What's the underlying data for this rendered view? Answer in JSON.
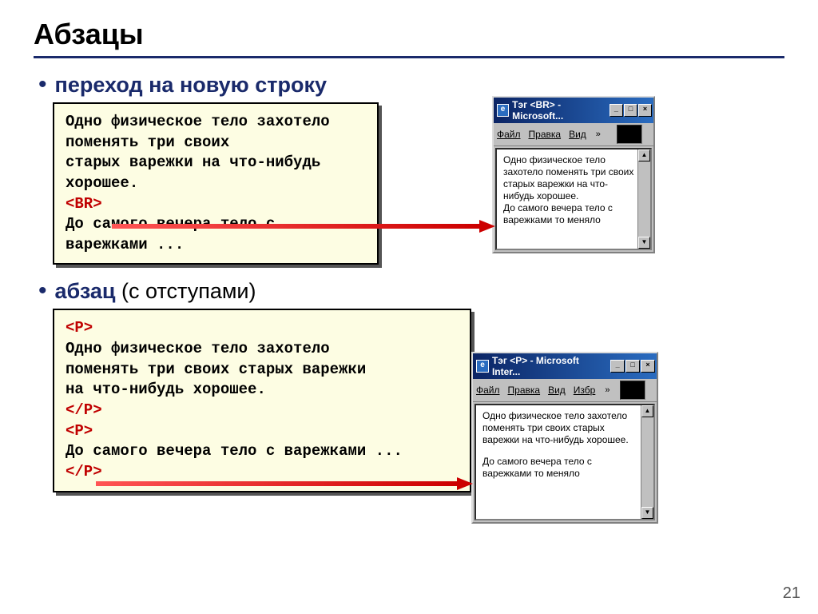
{
  "title": "Абзацы",
  "bullet1": "переход на новую строку",
  "bullet2_main": "абзац",
  "bullet2_sub": " (с отступами)",
  "code1": {
    "line1": "Одно физическое тело захотело",
    "line2": "поменять три своих",
    "line3": "старых варежки на что-нибудь",
    "line4": "хорошее.",
    "br_tag": "<BR>",
    "line5": "До самого вечера тело с",
    "line6": "варежками ..."
  },
  "code2": {
    "p_open": "<P>",
    "line1": "Одно физическое тело захотело",
    "line2": "поменять три своих старых варежки",
    "line3": "на что-нибудь хорошее.",
    "p_close": "</P>",
    "p_open2": "<P>",
    "line4": "До самого вечера тело с варежками ...",
    "p_close2": "</P>"
  },
  "ie1": {
    "title": "Тэг <BR> - Microsoft...",
    "menu": {
      "file": "Файл",
      "edit": "Правка",
      "view": "Вид"
    },
    "content_l1": "Одно физическое тело",
    "content_l2": "захотело поменять три своих",
    "content_l3": "старых варежки на что-",
    "content_l4": "нибудь хорошее.",
    "content_l5": "До самого вечера тело с",
    "content_l6": "варежками то меняло"
  },
  "ie2": {
    "title": "Тэг <P> - Microsoft Inter...",
    "menu": {
      "file": "Файл",
      "edit": "Правка",
      "view": "Вид",
      "fav": "Избр"
    },
    "content_l1": "Одно физическое тело захотело",
    "content_l2": "поменять три своих старых",
    "content_l3": "варежки на что-нибудь хорошее.",
    "content_l4": "До самого вечера тело с",
    "content_l5": "варежками то меняло"
  },
  "page_number": "21"
}
